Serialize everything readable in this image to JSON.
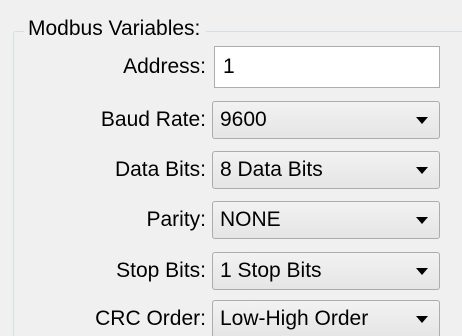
{
  "group": {
    "title": "Modbus Variables:"
  },
  "fields": {
    "address": {
      "label": "Address:",
      "value": "1"
    },
    "baud_rate": {
      "label": "Baud Rate:",
      "value": "9600",
      "icon": "chevron-down-icon"
    },
    "data_bits": {
      "label": "Data Bits:",
      "value": "8 Data Bits",
      "icon": "chevron-down-icon"
    },
    "parity": {
      "label": "Parity:",
      "value": "NONE",
      "icon": "chevron-down-icon"
    },
    "stop_bits": {
      "label": "Stop Bits:",
      "value": "1 Stop Bits",
      "icon": "chevron-down-icon"
    },
    "crc_order": {
      "label": "CRC Order:",
      "value": "Low-High Order",
      "icon": "chevron-down-icon"
    }
  }
}
